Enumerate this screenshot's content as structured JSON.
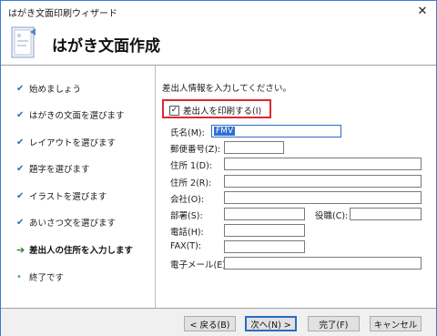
{
  "window": {
    "title": "はがき文面印刷ウィザード",
    "close_glyph": "✕"
  },
  "header": {
    "title": "はがき文面作成",
    "icon": "postcard-icon"
  },
  "sidebar": {
    "items": [
      {
        "label": "始めましょう",
        "status": "done",
        "mark": "✔"
      },
      {
        "label": "はがきの文面を選びます",
        "status": "done",
        "mark": "✔"
      },
      {
        "label": "レイアウトを選びます",
        "status": "done",
        "mark": "✔"
      },
      {
        "label": "題字を選びます",
        "status": "done",
        "mark": "✔"
      },
      {
        "label": "イラストを選びます",
        "status": "done",
        "mark": "✔"
      },
      {
        "label": "あいさつ文を選びます",
        "status": "done",
        "mark": "✔"
      },
      {
        "label": "差出人の住所を入力します",
        "status": "current",
        "mark": "➔"
      },
      {
        "label": "終了です",
        "status": "pending",
        "mark": "•"
      }
    ]
  },
  "main": {
    "instruction": "差出人情報を入力してください。",
    "print_sender": {
      "label": "差出人を印刷する(I)",
      "checked": true,
      "check_glyph": "✓"
    },
    "fields": {
      "name": {
        "label": "氏名(M):",
        "value": "FMV"
      },
      "zip": {
        "label": "郵便番号(Z):",
        "value": ""
      },
      "address1": {
        "label": "住所 1(D):",
        "value": ""
      },
      "address2": {
        "label": "住所 2(R):",
        "value": ""
      },
      "company": {
        "label": "会社(O):",
        "value": ""
      },
      "department": {
        "label": "部署(S):",
        "value": ""
      },
      "title": {
        "label": "役職(C):",
        "value": ""
      },
      "phone": {
        "label": "電話(H):",
        "value": ""
      },
      "fax": {
        "label": "FAX(T):",
        "value": ""
      },
      "email": {
        "label": "電子メール(E):",
        "value": ""
      }
    }
  },
  "footer": {
    "back": "< 戻る(B)",
    "next": "次へ(N) >",
    "finish": "完了(F)",
    "cancel": "キャンセル"
  },
  "colors": {
    "accent": "#2b6cc0",
    "highlight_border": "#e0262f",
    "selection": "#2f6fd0"
  }
}
